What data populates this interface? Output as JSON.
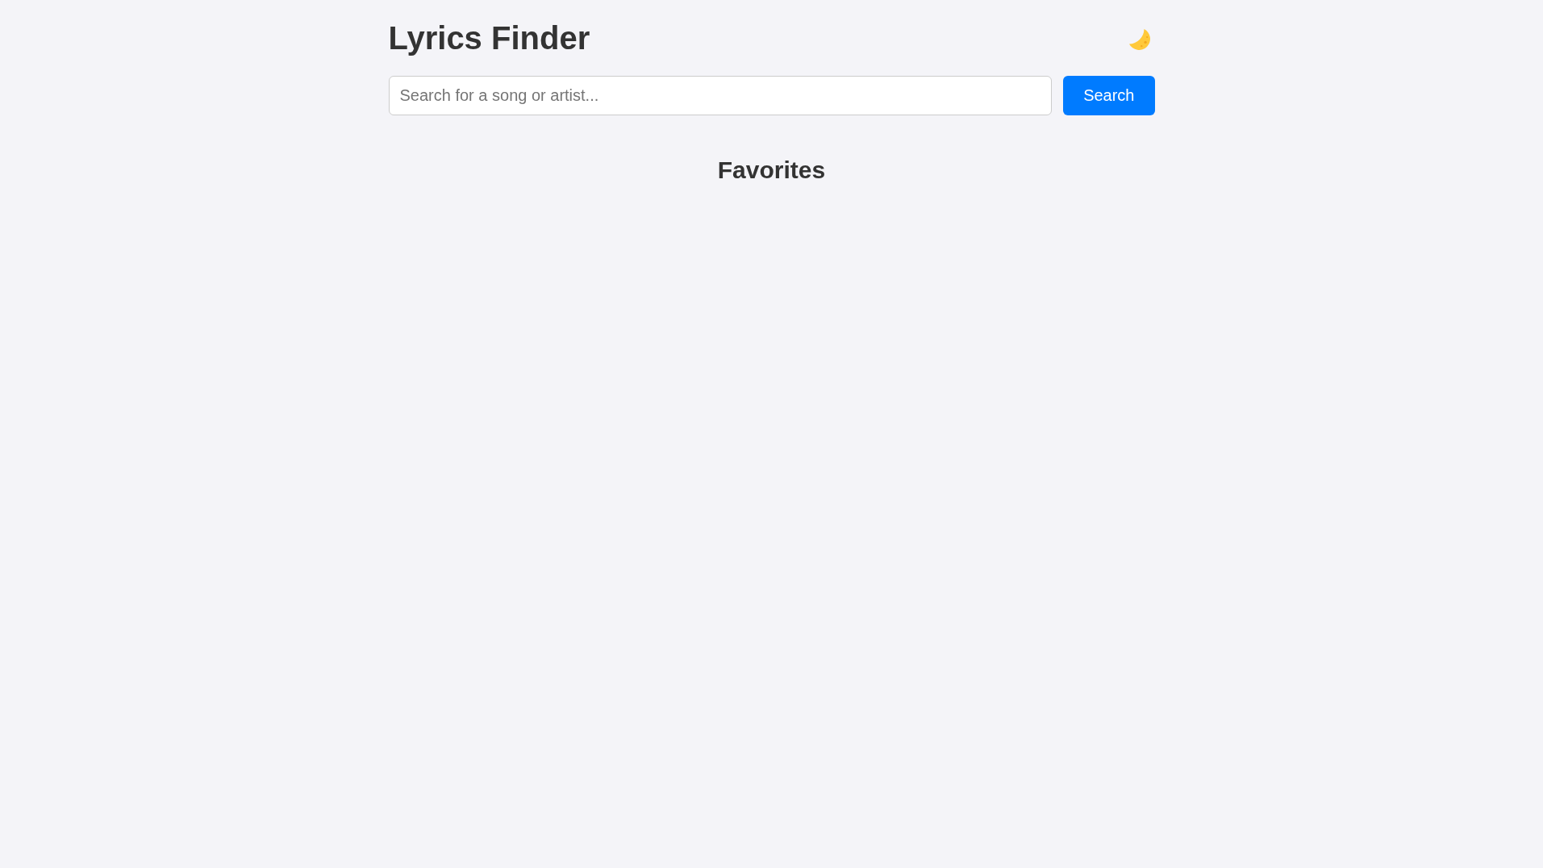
{
  "header": {
    "title": "Lyrics Finder"
  },
  "search": {
    "placeholder": "Search for a song or artist...",
    "button": "Search"
  },
  "favorites": {
    "heading": "Favorites"
  }
}
